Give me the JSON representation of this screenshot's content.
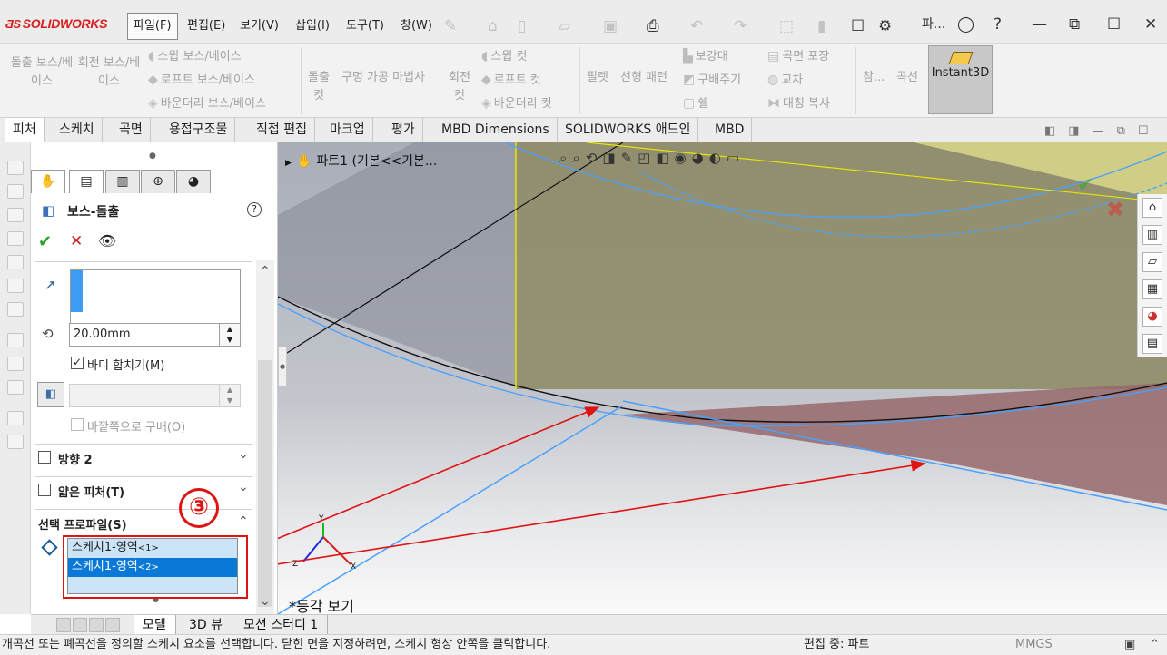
{
  "app": {
    "logo": "SOLIDWORKS"
  },
  "menu": [
    "파일(F)",
    "편집(E)",
    "보기(V)",
    "삽입(I)",
    "도구(T)",
    "창(W)"
  ],
  "window_short_title": "파...",
  "ribbon": {
    "boss_extrude": "돌출 보스/베이스",
    "revolve_boss": "회전 보스/베이스",
    "sweep_boss": "스윕 보스/베이스",
    "loft_boss": "로프트 보스/베이스",
    "boundary_boss": "바운더리 보스/베이스",
    "extrude_cut": "돌출 컷",
    "hole_wizard": "구멍 가공 마법사",
    "revolve_cut": "회전 컷",
    "sweep_cut": "스윕 컷",
    "loft_cut": "로프트 컷",
    "boundary_cut": "바운더리 컷",
    "fillet": "필렛",
    "linear_pattern": "선형 패턴",
    "rib": "보강대",
    "draft": "구배주기",
    "shell": "쉘",
    "wrap": "곡면 포장",
    "intersect": "교차",
    "mirror": "대칭 복사",
    "ref_geom": "참...",
    "curves": "곡선",
    "instant3d": "Instant3D"
  },
  "tabs": [
    "피처",
    "스케치",
    "곡면",
    "용접구조물",
    "직접 편집",
    "마크업",
    "평가",
    "MBD Dimensions",
    "SOLIDWORKS 애드인",
    "MBD"
  ],
  "property_manager": {
    "title": "보스-돌출",
    "depth_value": "20.00mm",
    "merge_result_label": "바디 합치기(M)",
    "merge_result_checked": true,
    "draft_outward_label": "바깥쪽으로 구배(O)",
    "direction2_label": "방향 2",
    "thin_feature_label": "얇은 피처(T)",
    "selected_contours_label": "선택 프로파일(S)",
    "selected_contours": [
      {
        "name": "스케치1-영역",
        "index": "<1>",
        "selected": false
      },
      {
        "name": "스케치1-영역",
        "index": "<2>",
        "selected": true
      }
    ]
  },
  "annotation": {
    "step": "③",
    "color": "#e01313"
  },
  "viewport": {
    "tree_label": "파트1  (기본<<기본...",
    "view_name": "*등각 보기",
    "triad": {
      "x": "X",
      "y": "Y",
      "z": "Z"
    }
  },
  "bottom_tabs": [
    "모델",
    "3D 뷰",
    "모션 스터디 1"
  ],
  "status": {
    "message": "개곡선 또는 폐곡선을 정의할 스케치 요소를 선택합니다. 닫힌 면을 지정하려면, 스케치 형상 안쪽을 클릭합니다.",
    "editing": "편집 중: 파트",
    "units": "MMGS"
  }
}
